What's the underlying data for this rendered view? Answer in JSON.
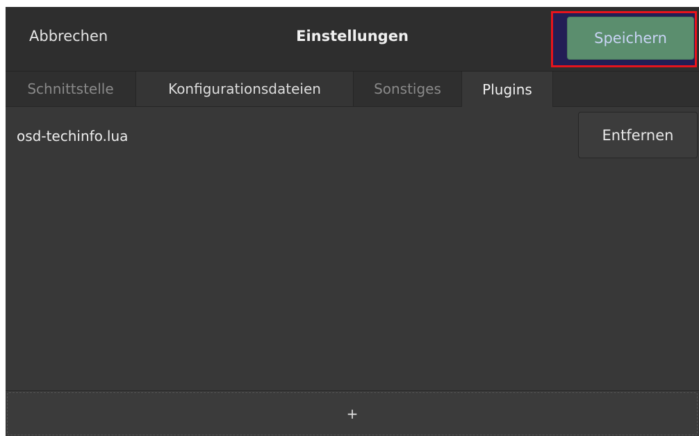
{
  "header": {
    "cancel_label": "Abbrechen",
    "title": "Einstellungen",
    "save_label": "Speichern"
  },
  "tabs": [
    {
      "label": "Schnittstelle"
    },
    {
      "label": "Konfigurationsdateien"
    },
    {
      "label": "Sonstiges"
    },
    {
      "label": "Plugins"
    }
  ],
  "plugins": {
    "items": [
      {
        "name": "osd-techinfo.lua",
        "remove_label": "Entfernen"
      }
    ],
    "add_label": "+"
  },
  "colors": {
    "save_button": "#5b8e6e",
    "highlight": "#e8141c",
    "background": "#383838"
  }
}
